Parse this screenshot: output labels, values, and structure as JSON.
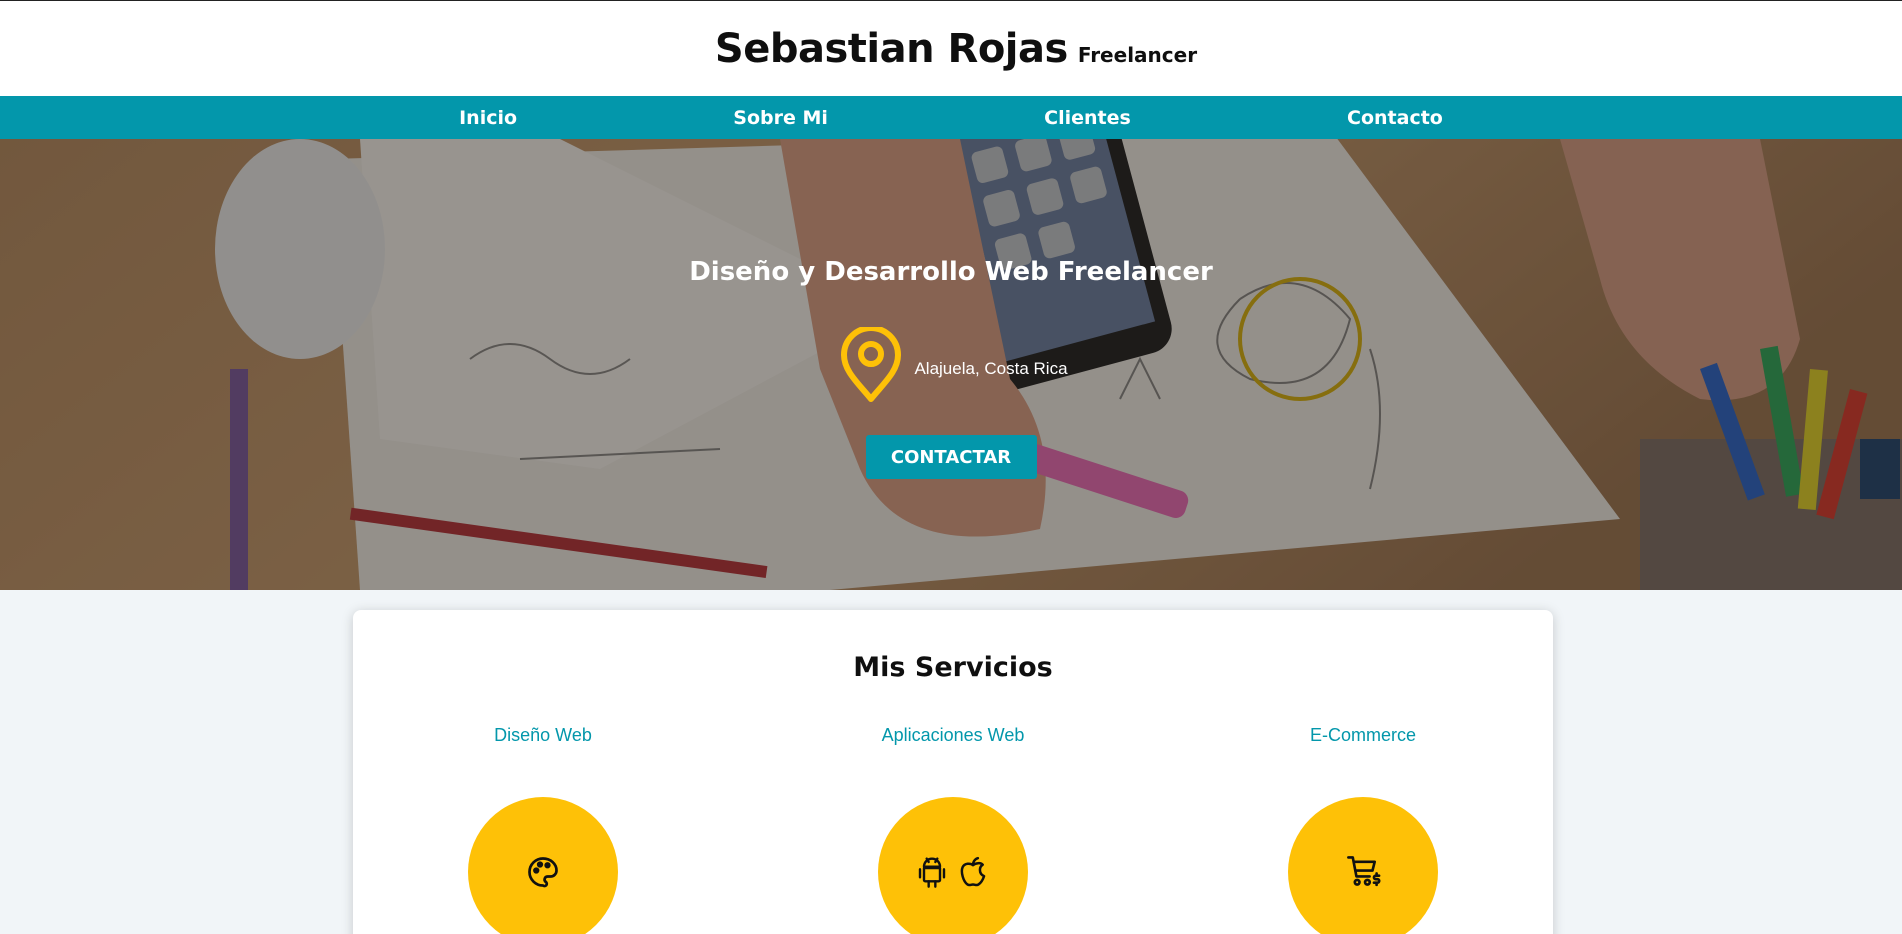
{
  "header": {
    "name": "Sebastian Rojas",
    "tagline": "Freelancer"
  },
  "nav": {
    "items": [
      {
        "label": "Inicio"
      },
      {
        "label": "Sobre Mi"
      },
      {
        "label": "Clientes"
      },
      {
        "label": "Contacto"
      }
    ]
  },
  "hero": {
    "title": "Diseño y Desarrollo Web Freelancer",
    "location": "Alajuela, Costa Rica",
    "location_icon": "map-pin-icon",
    "cta_label": "CONTACTAR"
  },
  "services": {
    "title": "Mis Servicios",
    "items": [
      {
        "name": "Diseño Web",
        "icon": "palette-icon"
      },
      {
        "name": "Aplicaciones Web",
        "icon": "android-apple-icons"
      },
      {
        "name": "E-Commerce",
        "icon": "shopping-cart-dollar-icon"
      }
    ]
  },
  "colors": {
    "primary": "#0397ab",
    "accent": "#fec107",
    "background": "#f1f5f8"
  }
}
